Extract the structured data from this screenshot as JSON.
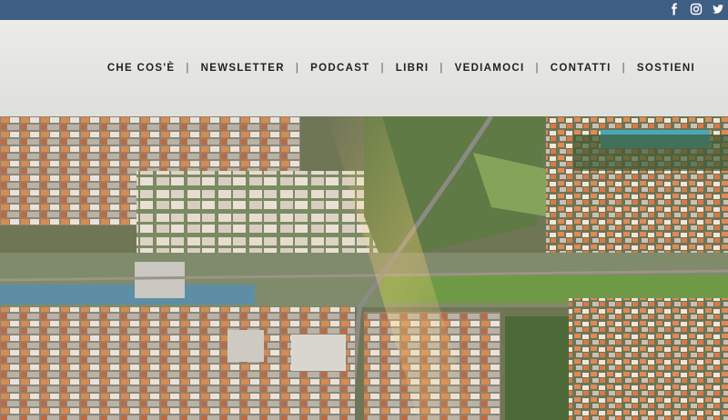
{
  "social": {
    "icons": [
      "facebook-icon",
      "instagram-icon",
      "twitter-icon"
    ]
  },
  "nav": {
    "items": [
      {
        "label": "CHE COS'È"
      },
      {
        "label": "NEWSLETTER"
      },
      {
        "label": "PODCAST"
      },
      {
        "label": "LIBRI"
      },
      {
        "label": "VEDIAMOCI"
      },
      {
        "label": "CONTATTI"
      },
      {
        "label": "SOSTIENI"
      }
    ],
    "separator": "|"
  },
  "colors": {
    "topbar": "#3f5e83",
    "header_overlay": "#f1f0ec",
    "nav_text": "#222222"
  }
}
